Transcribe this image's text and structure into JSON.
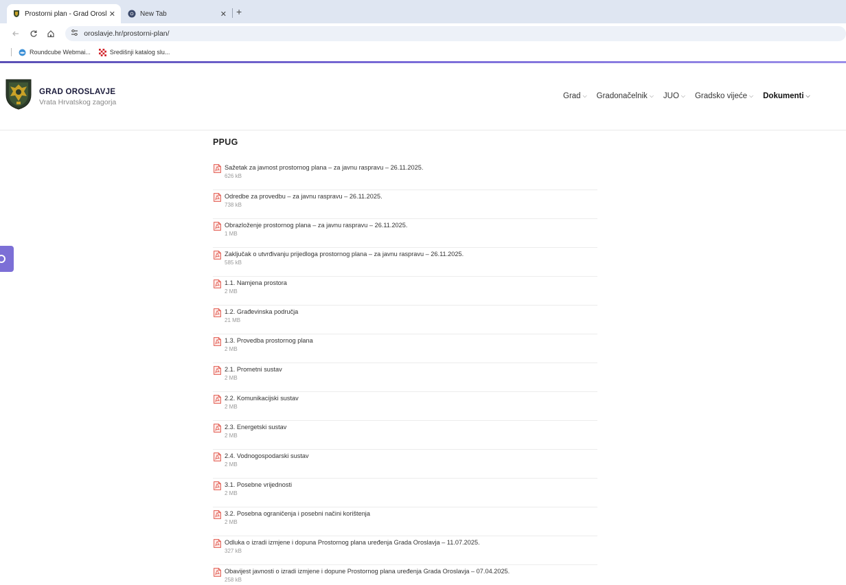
{
  "browser": {
    "tabs": [
      {
        "title": "Prostorni plan - Grad Oroslavje",
        "close": "✕",
        "active": true
      },
      {
        "title": "New Tab",
        "close": "✕",
        "active": false
      }
    ],
    "new_tab_label": "+",
    "address": "oroslavje.hr/prostorni-plan/",
    "bookmarks": [
      {
        "label": "Roundcube Webmai...",
        "icon": "roundcube-icon"
      },
      {
        "label": "Središnji katalog slu...",
        "icon": "croatian-checker-icon"
      }
    ]
  },
  "site": {
    "name": "GRAD OROSLAVJE",
    "tagline": "Vrata Hrvatskog zagorja",
    "nav": [
      {
        "label": "Grad"
      },
      {
        "label": "Gradonačelnik"
      },
      {
        "label": "JUO"
      },
      {
        "label": "Gradsko vijeće"
      },
      {
        "label": "Dokumenti"
      }
    ]
  },
  "content": {
    "section_title": "PPUG",
    "documents": [
      {
        "name": "Sažetak za javnost prostornog plana – za javnu raspravu – 26.11.2025.",
        "size": "626 kB"
      },
      {
        "name": "Odredbe za provedbu – za javnu raspravu – 26.11.2025.",
        "size": "738 kB"
      },
      {
        "name": "Obrazloženje prostornog plana – za javnu raspravu – 26.11.2025.",
        "size": "1 MB"
      },
      {
        "name": "Zaključak o utvrđivanju prijedloga prostornog plana – za javnu raspravu – 26.11.2025.",
        "size": "585 kB"
      },
      {
        "name": "1.1. Namjena prostora",
        "size": "2 MB"
      },
      {
        "name": "1.2. Građevinska područja",
        "size": "21 MB"
      },
      {
        "name": "1.3. Provedba prostornog plana",
        "size": "2 MB"
      },
      {
        "name": "2.1. Prometni sustav",
        "size": "2 MB"
      },
      {
        "name": "2.2. Komunikacijski sustav",
        "size": "2 MB"
      },
      {
        "name": "2.3. Energetski sustav",
        "size": "2 MB"
      },
      {
        "name": "2.4. Vodnogospodarski sustav",
        "size": "2 MB"
      },
      {
        "name": "3.1. Posebne vrijednosti",
        "size": "2 MB"
      },
      {
        "name": "3.2. Posebna ograničenja i posebni načini korištenja",
        "size": "2 MB"
      },
      {
        "name": "Odluka o izradi izmjene i dopuna Prostornog plana uređenja Grada Oroslavja – 11.07.2025.",
        "size": "327 kB"
      },
      {
        "name": "Obavijest javnosti o izradi izmjene i dopune Prostornog plana uređenja Grada Oroslavja – 07.04.2025.",
        "size": "258 kB"
      }
    ]
  },
  "colors": {
    "accent": "#7b6cd9",
    "pdf_icon": "#e2574c"
  }
}
